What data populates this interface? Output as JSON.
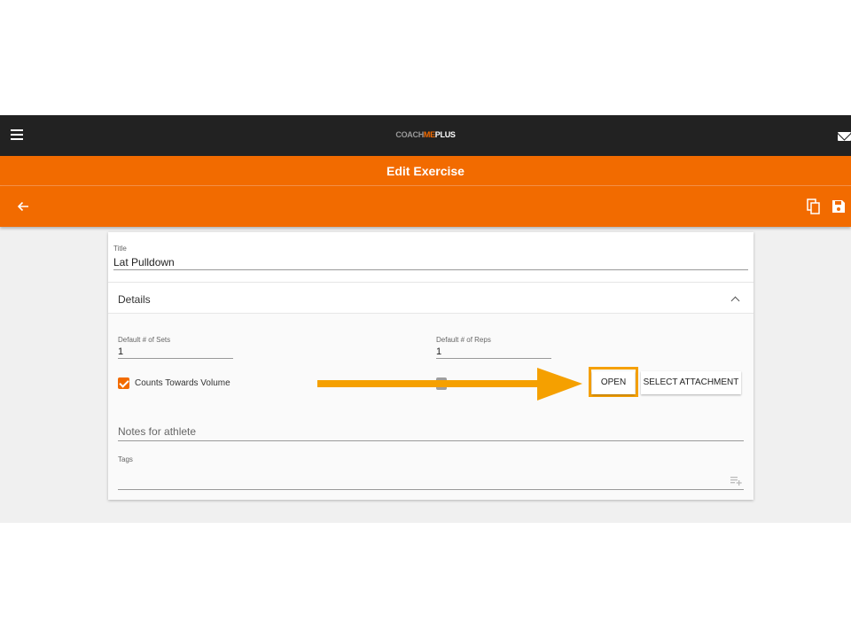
{
  "header": {
    "brand": {
      "part1": "COACH",
      "part2": "ME",
      "part3": "PLUS"
    },
    "menu_icon": "hamburger-menu-icon",
    "mail_icon": "mail-icon"
  },
  "titlebar": {
    "title": "Edit Exercise"
  },
  "actionbar": {
    "back_icon": "arrow-back-icon",
    "copy_icon": "copy-icon",
    "save_icon": "save-icon"
  },
  "form": {
    "title": {
      "label": "Title",
      "value": "Lat Pulldown"
    },
    "details": {
      "label": "Details",
      "expanded": true
    },
    "sets": {
      "label": "Default # of Sets",
      "value": "1"
    },
    "reps": {
      "label": "Default # of Reps",
      "value": "1"
    },
    "counts_towards_volume": {
      "label": "Counts Towards Volume",
      "checked": true
    },
    "buttons": {
      "open": "OPEN",
      "select_attachment": "SELECT ATTACHMENT"
    },
    "notes": {
      "placeholder": "Notes for athlete",
      "value": ""
    },
    "tags": {
      "label": "Tags",
      "value": ""
    }
  },
  "colors": {
    "accent": "#f26b00",
    "topbar": "#222222",
    "highlight": "#f5a000"
  }
}
